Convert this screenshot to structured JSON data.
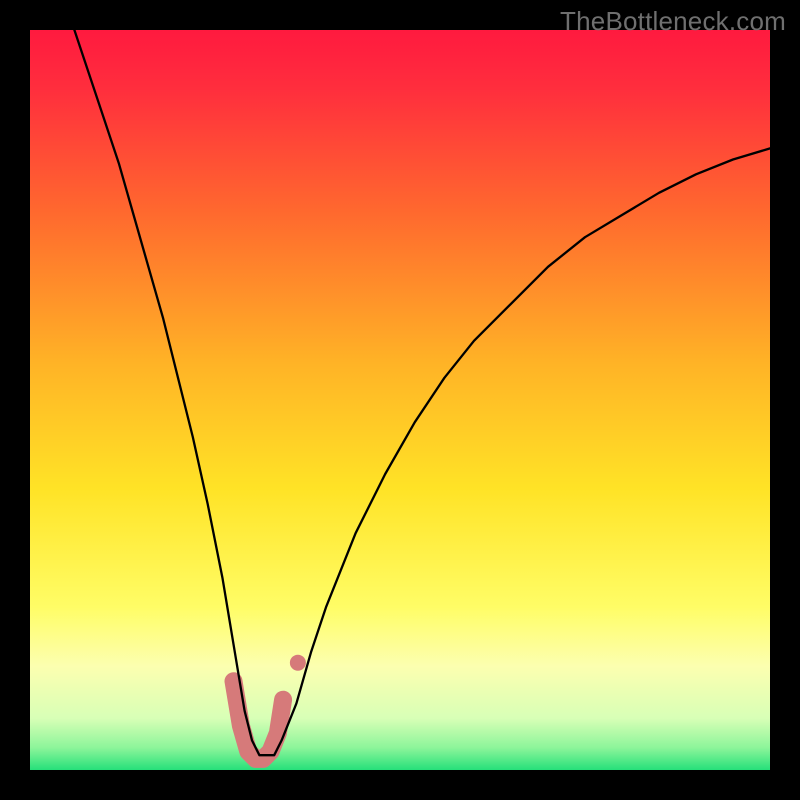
{
  "watermark": "TheBottleneck.com",
  "chart_data": {
    "type": "line",
    "title": "",
    "xlabel": "",
    "ylabel": "",
    "xlim": [
      0,
      100
    ],
    "ylim": [
      0,
      100
    ],
    "background_gradient": {
      "stops": [
        {
          "pos": 0.0,
          "color": "#ff1a3f"
        },
        {
          "pos": 0.08,
          "color": "#ff2e3d"
        },
        {
          "pos": 0.25,
          "color": "#ff6a2e"
        },
        {
          "pos": 0.45,
          "color": "#ffb326"
        },
        {
          "pos": 0.62,
          "color": "#ffe326"
        },
        {
          "pos": 0.78,
          "color": "#fffd66"
        },
        {
          "pos": 0.86,
          "color": "#fcffb0"
        },
        {
          "pos": 0.93,
          "color": "#d8ffb6"
        },
        {
          "pos": 0.97,
          "color": "#8cf59a"
        },
        {
          "pos": 1.0,
          "color": "#26e07a"
        }
      ]
    },
    "series": [
      {
        "name": "bottleneck-curve",
        "color": "#000000",
        "width": 2.3,
        "x": [
          6,
          8,
          10,
          12,
          14,
          16,
          18,
          20,
          22,
          24,
          26,
          27,
          28,
          29,
          30,
          31,
          32,
          33,
          34,
          36,
          38,
          40,
          44,
          48,
          52,
          56,
          60,
          65,
          70,
          75,
          80,
          85,
          90,
          95,
          100
        ],
        "values": [
          100,
          94,
          88,
          82,
          75,
          68,
          61,
          53,
          45,
          36,
          26,
          20,
          14,
          8,
          4,
          2,
          2,
          2,
          4,
          9,
          16,
          22,
          32,
          40,
          47,
          53,
          58,
          63,
          68,
          72,
          75,
          78,
          80.5,
          82.5,
          84
        ]
      }
    ],
    "highlight_band": {
      "name": "trough-highlight",
      "color": "#d67a7a",
      "width": 18,
      "cap": "round",
      "x": [
        27.5,
        28.5,
        29.5,
        30.5,
        31.5,
        32.5,
        33.5,
        34.2
      ],
      "y": [
        12.0,
        6.0,
        2.5,
        1.5,
        1.5,
        2.5,
        5.0,
        9.5
      ]
    },
    "highlight_dot": {
      "name": "curve-marker",
      "color": "#d67a7a",
      "r": 8,
      "x": 36.2,
      "y": 14.5
    }
  }
}
